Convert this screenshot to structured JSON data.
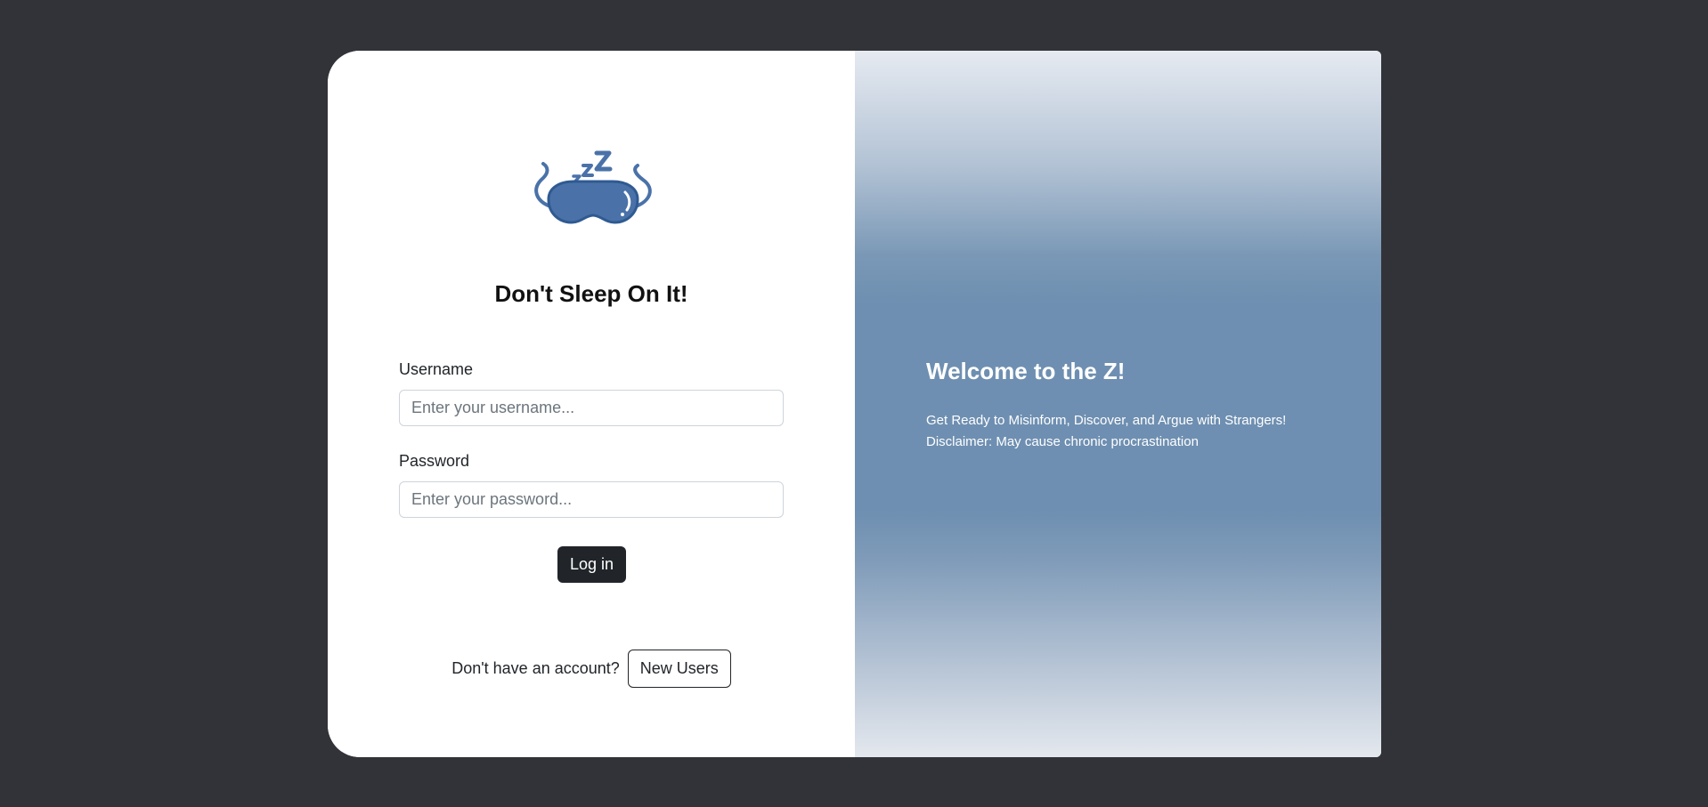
{
  "login": {
    "logo_icon": "sleep-mask-icon",
    "title": "Don't Sleep On It!",
    "username_label": "Username",
    "username_placeholder": "Enter your username...",
    "password_label": "Password",
    "password_placeholder": "Enter your password...",
    "login_button": "Log in",
    "signup_prompt": "Don't have an account?",
    "signup_button": "New Users"
  },
  "welcome": {
    "title": "Welcome to the Z!",
    "line1": "Get Ready to Misinform, Discover, and Argue with Strangers!",
    "line2": "Disclaimer: May cause chronic procrastination"
  },
  "colors": {
    "background": "#323338",
    "accent": "#4a72a9",
    "panel_gradient_mid": "#6e8fb1",
    "button_dark": "#212529"
  }
}
